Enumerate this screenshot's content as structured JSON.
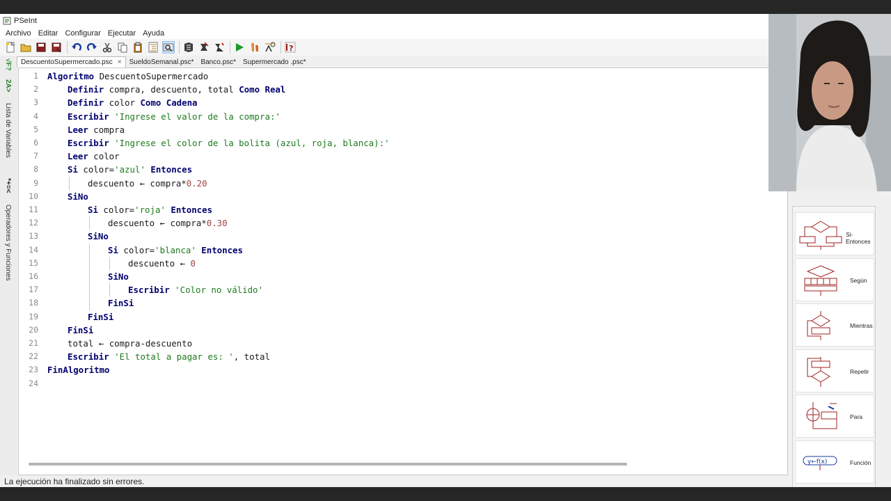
{
  "window": {
    "title": "PSeInt"
  },
  "menu": [
    "Archivo",
    "Editar",
    "Configurar",
    "Ejecutar",
    "Ayuda"
  ],
  "toolbar": {
    "groups": [
      [
        "new-icon",
        "open-icon",
        "save-icon",
        "save-as-icon"
      ],
      [
        "undo-icon",
        "redo-icon",
        "cut-icon",
        "copy-icon",
        "paste-icon",
        "indent-icon",
        "find-icon"
      ],
      [
        "flowchart-icon",
        "debug-icon",
        "step-icon"
      ],
      [
        "run-icon",
        "step-run-icon",
        "variables-icon"
      ],
      [
        "help-icon"
      ]
    ]
  },
  "tabs": [
    {
      "label": "DescuentoSupermercado.psc",
      "active": true,
      "close": "×"
    },
    {
      "label": "SueldoSemanal.psc*",
      "active": false
    },
    {
      "label": "Banco.psc*",
      "active": false
    },
    {
      "label": "Supermercado .psc*",
      "active": false
    }
  ],
  "left_panel": {
    "vars_label": "Lista de Variables",
    "vars_icon": "*+=<",
    "ops_label": "Operadores y Funciones",
    "ops_icon": "√F?",
    "ops_icon2": "2A>"
  },
  "editor": {
    "lines": [
      {
        "n": "1",
        "indent": 0,
        "tokens": [
          [
            "kw",
            "Algoritmo"
          ],
          [
            "id",
            " DescuentoSupermercado"
          ]
        ]
      },
      {
        "n": "2",
        "indent": 1,
        "tokens": [
          [
            "kw",
            "Definir"
          ],
          [
            "id",
            " compra, descuento, total "
          ],
          [
            "kw",
            "Como Real"
          ]
        ]
      },
      {
        "n": "3",
        "indent": 1,
        "tokens": [
          [
            "kw",
            "Definir"
          ],
          [
            "id",
            " color "
          ],
          [
            "kw",
            "Como Cadena"
          ]
        ]
      },
      {
        "n": "4",
        "indent": 1,
        "tokens": [
          [
            "kw",
            "Escribir"
          ],
          [
            "str",
            " 'Ingrese el valor de la compra:'"
          ]
        ]
      },
      {
        "n": "5",
        "indent": 1,
        "tokens": [
          [
            "kw",
            "Leer"
          ],
          [
            "id",
            " compra"
          ]
        ]
      },
      {
        "n": "6",
        "indent": 1,
        "tokens": [
          [
            "kw",
            "Escribir"
          ],
          [
            "str",
            " 'Ingrese el color de la bolita (azul, roja, blanca):'"
          ]
        ]
      },
      {
        "n": "7",
        "indent": 1,
        "tokens": [
          [
            "kw",
            "Leer"
          ],
          [
            "id",
            " color"
          ]
        ]
      },
      {
        "n": "8",
        "indent": 1,
        "tokens": [
          [
            "kw",
            "Si"
          ],
          [
            "id",
            " color="
          ],
          [
            "str",
            "'azul'"
          ],
          [
            "kw",
            " Entonces"
          ]
        ]
      },
      {
        "n": "9",
        "indent": 2,
        "tokens": [
          [
            "id",
            "descuento "
          ],
          [
            "op",
            "←"
          ],
          [
            "id",
            " compra*"
          ],
          [
            "num",
            "0.20"
          ]
        ]
      },
      {
        "n": "10",
        "indent": 1,
        "tokens": [
          [
            "kw",
            "SiNo"
          ]
        ]
      },
      {
        "n": "11",
        "indent": 2,
        "tokens": [
          [
            "kw",
            "Si"
          ],
          [
            "id",
            " color="
          ],
          [
            "str",
            "'roja'"
          ],
          [
            "kw",
            " Entonces"
          ]
        ]
      },
      {
        "n": "12",
        "indent": 3,
        "tokens": [
          [
            "id",
            "descuento "
          ],
          [
            "op",
            "←"
          ],
          [
            "id",
            " compra*"
          ],
          [
            "num",
            "0.30"
          ]
        ]
      },
      {
        "n": "13",
        "indent": 2,
        "tokens": [
          [
            "kw",
            "SiNo"
          ]
        ]
      },
      {
        "n": "14",
        "indent": 3,
        "tokens": [
          [
            "kw",
            "Si"
          ],
          [
            "id",
            " color="
          ],
          [
            "str",
            "'blanca'"
          ],
          [
            "kw",
            " Entonces"
          ]
        ]
      },
      {
        "n": "15",
        "indent": 4,
        "tokens": [
          [
            "id",
            "descuento "
          ],
          [
            "op",
            "←"
          ],
          [
            "num",
            " 0"
          ]
        ]
      },
      {
        "n": "16",
        "indent": 3,
        "tokens": [
          [
            "kw",
            "SiNo"
          ]
        ]
      },
      {
        "n": "17",
        "indent": 4,
        "tokens": [
          [
            "kw",
            "Escribir"
          ],
          [
            "str",
            " 'Color no válido'"
          ]
        ]
      },
      {
        "n": "18",
        "indent": 3,
        "tokens": [
          [
            "kw",
            "FinSi"
          ]
        ]
      },
      {
        "n": "19",
        "indent": 2,
        "tokens": [
          [
            "kw",
            "FinSi"
          ]
        ]
      },
      {
        "n": "20",
        "indent": 1,
        "tokens": [
          [
            "kw",
            "FinSi"
          ]
        ]
      },
      {
        "n": "21",
        "indent": 1,
        "tokens": [
          [
            "id",
            "total "
          ],
          [
            "op",
            "←"
          ],
          [
            "id",
            " compra-descuento"
          ]
        ]
      },
      {
        "n": "22",
        "indent": 1,
        "tokens": [
          [
            "kw",
            "Escribir"
          ],
          [
            "str",
            " 'El total a pagar es: '"
          ],
          [
            "id",
            ", total"
          ]
        ]
      },
      {
        "n": "23",
        "indent": 0,
        "tokens": [
          [
            "kw",
            "FinAlgoritmo"
          ]
        ]
      },
      {
        "n": "24",
        "indent": 0,
        "tokens": []
      }
    ]
  },
  "status": {
    "text": "La ejecución ha finalizado sin errores."
  },
  "commands": [
    {
      "label": "Si-Entonces",
      "icon": "if-then-icon"
    },
    {
      "label": "Según",
      "icon": "switch-icon"
    },
    {
      "label": "Mientras",
      "icon": "while-icon"
    },
    {
      "label": "Repetir",
      "icon": "repeat-icon"
    },
    {
      "label": "Para",
      "icon": "for-icon"
    },
    {
      "label": "Función",
      "icon": "function-icon"
    }
  ],
  "colors": {
    "keyword": "#00006f",
    "string": "#1e7a1e",
    "number": "#a04545",
    "flow_icon": "#a02020"
  }
}
